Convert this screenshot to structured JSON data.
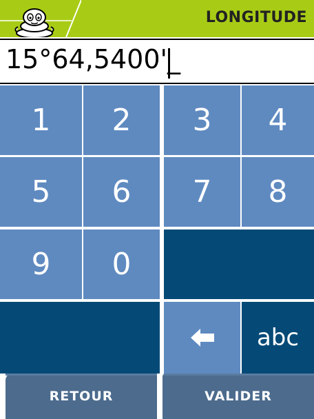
{
  "header": {
    "title": "LONGITUDE",
    "logo_icon": "michelin-bibendum-logo",
    "accent_color": "#a8cc16"
  },
  "input": {
    "value": "15°64,5400'_"
  },
  "keypad": {
    "key_color": "#5f8ac0",
    "dark_color": "#054a77",
    "keys": {
      "k1": "1",
      "k2": "2",
      "k3": "3",
      "k4": "4",
      "k5": "5",
      "k6": "6",
      "k7": "7",
      "k8": "8",
      "k9": "9",
      "k0": "0",
      "abc": "abc",
      "backspace_icon": "left-arrow-icon"
    }
  },
  "footer": {
    "back_label": "RETOUR",
    "validate_label": "VALIDER",
    "button_color": "#4c6b8d"
  }
}
